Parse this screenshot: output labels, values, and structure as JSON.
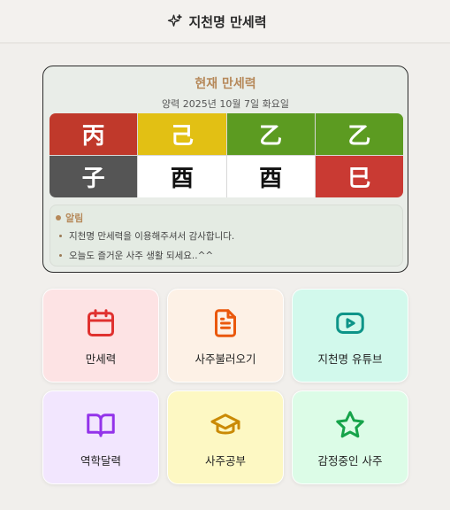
{
  "header": {
    "title": "지천명 만세력",
    "icon": "sparkle-icon"
  },
  "today_card": {
    "title": "현재 만세력",
    "date": "양력 2025년 10월 7일 화요일",
    "pillars": {
      "stems": [
        {
          "char": "丙",
          "bg": "#c0392b",
          "fg": "#ffffff"
        },
        {
          "char": "己",
          "bg": "#e2c014",
          "fg": "#ffffff"
        },
        {
          "char": "乙",
          "bg": "#5c9b21",
          "fg": "#ffffff"
        },
        {
          "char": "乙",
          "bg": "#5c9b21",
          "fg": "#ffffff"
        }
      ],
      "branches": [
        {
          "char": "子",
          "bg": "#555555",
          "fg": "#ffffff"
        },
        {
          "char": "酉",
          "bg": "#ffffff",
          "fg": "#111111"
        },
        {
          "char": "酉",
          "bg": "#ffffff",
          "fg": "#111111"
        },
        {
          "char": "巳",
          "bg": "#c93a33",
          "fg": "#ffffff"
        }
      ]
    },
    "notice": {
      "heading": "알림",
      "lines": [
        "지천명 만세력을 이용해주셔서 감사합니다.",
        "오늘도 즐거운 사주 생활 되세요..^^"
      ]
    }
  },
  "menu": [
    {
      "label": "만세력",
      "icon": "calendar-icon",
      "bg": "#fde3e4",
      "color": "#e0312f"
    },
    {
      "label": "사주불러오기",
      "icon": "document-icon",
      "bg": "#fdf1e6",
      "color": "#ea580c"
    },
    {
      "label": "지천명 유튜브",
      "icon": "youtube-play-icon",
      "bg": "#d2f9ec",
      "color": "#0d9488"
    },
    {
      "label": "역학달력",
      "icon": "open-book-icon",
      "bg": "#f2e6fe",
      "color": "#9333ea"
    },
    {
      "label": "사주공부",
      "icon": "graduation-cap-icon",
      "bg": "#fdf8c3",
      "color": "#ca8a04"
    },
    {
      "label": "감정중인 사주",
      "icon": "star-icon",
      "bg": "#dcfce7",
      "color": "#16a34a"
    }
  ]
}
